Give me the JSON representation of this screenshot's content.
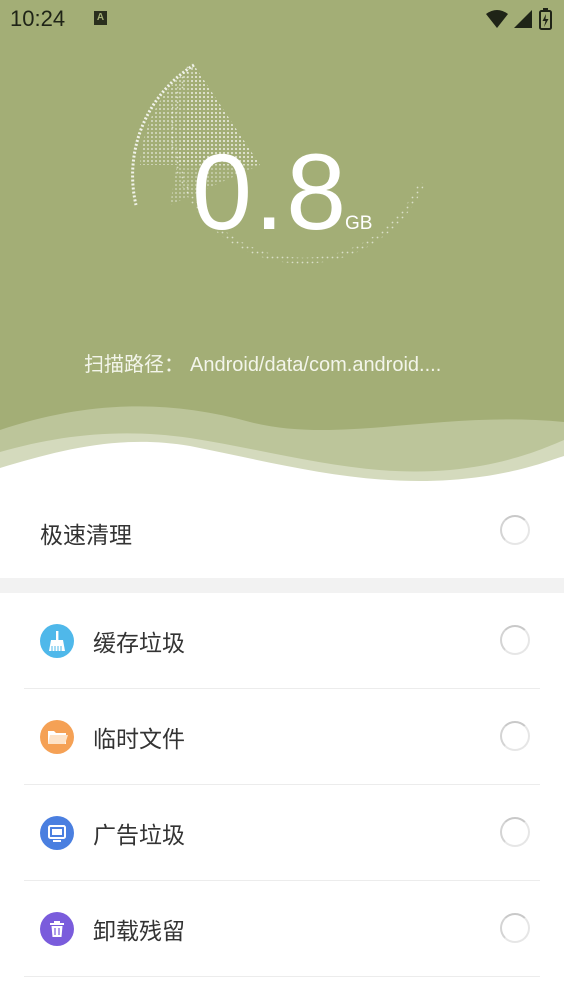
{
  "status_bar": {
    "time": "10:24",
    "notification_icon": "A"
  },
  "scan": {
    "size_value": "0.8",
    "size_unit": "GB",
    "path_label": "扫描路径：",
    "path_value": "Android/data/com.android...."
  },
  "quick_clean": {
    "label": "极速清理"
  },
  "categories": [
    {
      "label": "缓存垃圾",
      "icon": "broom-icon",
      "color": "#4fb8ea"
    },
    {
      "label": "临时文件",
      "icon": "folder-icon",
      "color": "#f5a155"
    },
    {
      "label": "广告垃圾",
      "icon": "monitor-icon",
      "color": "#4a7fe0"
    },
    {
      "label": "卸载残留",
      "icon": "trash-icon",
      "color": "#7a5cdc"
    }
  ],
  "colors": {
    "header_bg": "#a3ae76",
    "text": "#333333"
  }
}
